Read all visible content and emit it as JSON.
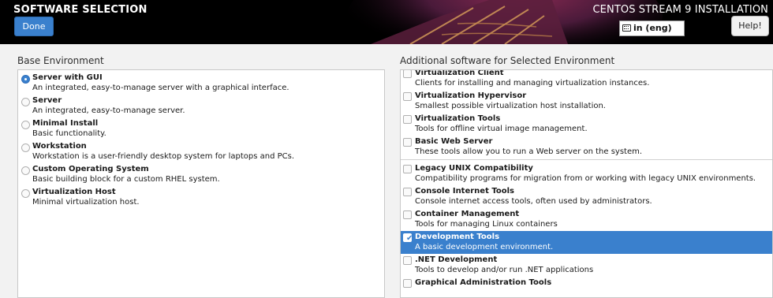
{
  "header": {
    "page_title": "SOFTWARE SELECTION",
    "done_label": "Done",
    "product_title": "CENTOS STREAM 9 INSTALLATION",
    "keyboard_layout": "in (eng)",
    "help_label": "Help!"
  },
  "base_environment": {
    "heading": "Base Environment",
    "selected": "Server with GUI",
    "items": [
      {
        "name": "Server with GUI",
        "desc": "An integrated, easy-to-manage server with a graphical interface.",
        "checked": true
      },
      {
        "name": "Server",
        "desc": "An integrated, easy-to-manage server.",
        "checked": false
      },
      {
        "name": "Minimal Install",
        "desc": "Basic functionality.",
        "checked": false
      },
      {
        "name": "Workstation",
        "desc": "Workstation is a user-friendly desktop system for laptops and PCs.",
        "checked": false
      },
      {
        "name": "Custom Operating System",
        "desc": "Basic building block for a custom RHEL system.",
        "checked": false
      },
      {
        "name": "Virtualization Host",
        "desc": "Minimal virtualization host.",
        "checked": false
      }
    ]
  },
  "additional_software": {
    "heading": "Additional software for Selected Environment",
    "items": [
      {
        "name": "Virtualization Client",
        "desc": "Clients for installing and managing virtualization instances.",
        "checked": false,
        "highlighted": false
      },
      {
        "name": "Virtualization Hypervisor",
        "desc": "Smallest possible virtualization host installation.",
        "checked": false,
        "highlighted": false
      },
      {
        "name": "Virtualization Tools",
        "desc": "Tools for offline virtual image management.",
        "checked": false,
        "highlighted": false
      },
      {
        "name": "Basic Web Server",
        "desc": "These tools allow you to run a Web server on the system.",
        "checked": false,
        "highlighted": false
      },
      {
        "name": "Legacy UNIX Compatibility",
        "desc": "Compatibility programs for migration from or working with legacy UNIX environments.",
        "checked": false,
        "highlighted": false
      },
      {
        "name": "Console Internet Tools",
        "desc": "Console internet access tools, often used by administrators.",
        "checked": false,
        "highlighted": false
      },
      {
        "name": "Container Management",
        "desc": "Tools for managing Linux containers",
        "checked": false,
        "highlighted": false
      },
      {
        "name": "Development Tools",
        "desc": "A basic development environment.",
        "checked": true,
        "highlighted": true
      },
      {
        "name": ".NET Development",
        "desc": "Tools to develop and/or run .NET applications",
        "checked": false,
        "highlighted": false
      },
      {
        "name": "Graphical Administration Tools",
        "desc": "",
        "checked": false,
        "highlighted": false
      }
    ]
  },
  "colors": {
    "accent": "#3a80cd",
    "header_bg": "#000000",
    "panel_bg": "#ffffff",
    "page_bg": "#f2f2f2"
  }
}
